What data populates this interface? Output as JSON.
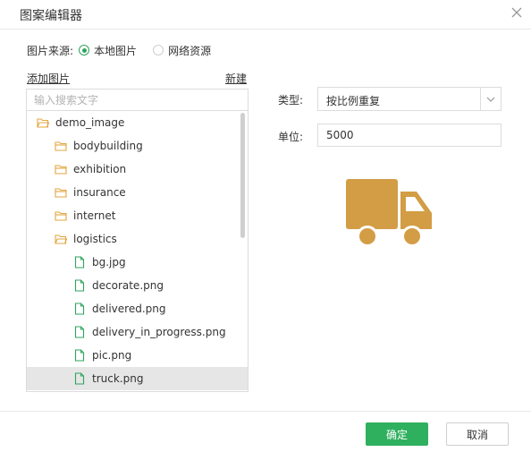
{
  "dialog": {
    "title": "图案编辑器"
  },
  "source": {
    "label": "图片来源:",
    "options": [
      {
        "label": "本地图片",
        "checked": true
      },
      {
        "label": "网络资源",
        "checked": false
      }
    ]
  },
  "actions": {
    "add_image": "添加图片",
    "new": "新建"
  },
  "search": {
    "placeholder": "输入搜索文字",
    "value": ""
  },
  "tree": {
    "items": [
      {
        "label": "demo_image",
        "type": "folder",
        "level": 0
      },
      {
        "label": "bodybuilding",
        "type": "folder",
        "level": 1
      },
      {
        "label": "exhibition",
        "type": "folder",
        "level": 1
      },
      {
        "label": "insurance",
        "type": "folder",
        "level": 1
      },
      {
        "label": "internet",
        "type": "folder",
        "level": 1
      },
      {
        "label": "logistics",
        "type": "folder",
        "level": 1
      },
      {
        "label": "bg.jpg",
        "type": "file",
        "level": 2
      },
      {
        "label": "decorate.png",
        "type": "file",
        "level": 2
      },
      {
        "label": "delivered.png",
        "type": "file",
        "level": 2
      },
      {
        "label": "delivery_in_progress.png",
        "type": "file",
        "level": 2
      },
      {
        "label": "pic.png",
        "type": "file",
        "level": 2
      },
      {
        "label": "truck.png",
        "type": "file",
        "level": 2,
        "selected": true
      }
    ]
  },
  "form": {
    "type_label": "类型:",
    "type_value": "按比例重复",
    "unit_label": "单位:",
    "unit_value": "5000"
  },
  "preview": {
    "icon": "truck-icon",
    "color": "#d39d45"
  },
  "footer": {
    "ok_label": "确定",
    "cancel_label": "取消"
  },
  "colors": {
    "accent": "#2fb05e",
    "folder_icon": "#e3a640",
    "file_icon": "#2fa45e"
  }
}
